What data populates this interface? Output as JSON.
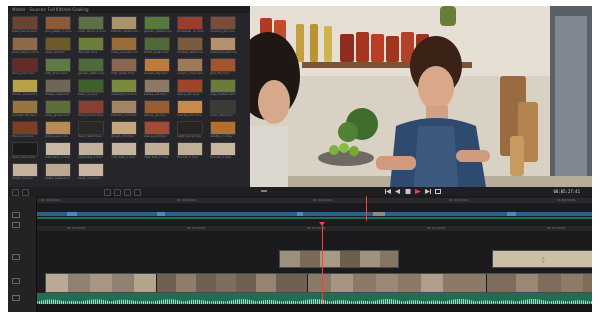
{
  "app": {
    "media_pool": {
      "title": "Master · Sources: Full Kitchen Cooking",
      "clips": [
        {
          "name": "fresh_sauce.mov",
          "tone": "#6b4332"
        },
        {
          "name": "pan_pasta_1.mov",
          "tone": "#8a5a3a"
        },
        {
          "name": "cook_shoot_a.mov",
          "tone": "#5c6f45"
        },
        {
          "name": "kitchen_wide.mov",
          "tone": "#a9936f"
        },
        {
          "name": "garden_herbs.mov",
          "tone": "#567a3e"
        },
        {
          "name": "tomatoes_cu.mov",
          "tone": "#9b3d2c"
        },
        {
          "name": "cooking_09.mov",
          "tone": "#7a4c39"
        },
        {
          "name": "prep_table_2.mov",
          "tone": "#8d6a4a"
        },
        {
          "name": "olive_oil.mov",
          "tone": "#6d5a2a"
        },
        {
          "name": "field_01.mov",
          "tone": "#6a7d3a"
        },
        {
          "name": "vines_sunset.mov",
          "tone": "#9a6d36"
        },
        {
          "name": "herbs_bowl.mov",
          "tone": "#4f6a38"
        },
        {
          "name": "market_stall.mov",
          "tone": "#7b5a3e"
        },
        {
          "name": "bread_dough.mov",
          "tone": "#b4916a"
        },
        {
          "name": "wine_pour.mov",
          "tone": "#6a2a2a"
        },
        {
          "name": "hills_drive.mov",
          "tone": "#5f7a42"
        },
        {
          "name": "garden_walk.mov",
          "tone": "#4d6b3a"
        },
        {
          "name": "chef_smile.mov",
          "tone": "#8a6650"
        },
        {
          "name": "sunset_sky.mov",
          "tone": "#c07a3a"
        },
        {
          "name": "onions_chop.mov",
          "tone": "#9c7a5a"
        },
        {
          "name": "grill_fire.mov",
          "tone": "#a4532a"
        },
        {
          "name": "lemon_slice.mov",
          "tone": "#b7a24a"
        },
        {
          "name": "street_view.mov",
          "tone": "#6e6658"
        },
        {
          "name": "basil_cu.mov",
          "tone": "#3f5f2c"
        },
        {
          "name": "vineyard_01.mov",
          "tone": "#7a8a3e"
        },
        {
          "name": "plates_set.mov",
          "tone": "#8c7a66"
        },
        {
          "name": "sauce_stir.mov",
          "tone": "#a0442c"
        },
        {
          "name": "veg_market.mov",
          "tone": "#6a7b3c"
        },
        {
          "name": "harvest_02.mov",
          "tone": "#96753f"
        },
        {
          "name": "olive_grove.mov",
          "tone": "#5e6e3a"
        },
        {
          "name": "meat_board.mov",
          "tone": "#8a3f34"
        },
        {
          "name": "kitchen_cu2.mov",
          "tone": "#a28466"
        },
        {
          "name": "spices_jar.mov",
          "tone": "#9a5d32"
        },
        {
          "name": "sunrise_hill.mov",
          "tone": "#c8894a"
        },
        {
          "name": "oven_door.mov",
          "tone": "#3e3a36"
        },
        {
          "name": "fire_wood.mov",
          "tone": "#7a3f24"
        },
        {
          "name": "pizza_peel.mov",
          "tone": "#b88a54"
        },
        {
          "name": "dark_cellar.mov",
          "tone": "#2c2826"
        },
        {
          "name": "dough_roll.mov",
          "tone": "#c5a57c"
        },
        {
          "name": "sauce_pot.mov",
          "tone": "#a34a34"
        },
        {
          "name": "night_lamp.mov",
          "tone": "#2a2420"
        },
        {
          "name": "candle_cu.mov",
          "tone": "#b0702e"
        },
        {
          "name": "dark_room.mov",
          "tone": "#1c1a18"
        },
        {
          "name": "interview_1.mov",
          "tone": "#c9b8a3"
        },
        {
          "name": "interview_2.mov",
          "tone": "#c2b19b"
        },
        {
          "name": "chef_talk_1.mov",
          "tone": "#c6b59f"
        },
        {
          "name": "chef_talk_2.mov",
          "tone": "#c0ad96"
        },
        {
          "name": "friends_1.mov",
          "tone": "#bfae98"
        },
        {
          "name": "friends_2.mov",
          "tone": "#c8b7a0"
        },
        {
          "name": "laugh_cu.mov",
          "tone": "#c4b29c"
        },
        {
          "name": "pasta_table.mov",
          "tone": "#bba892"
        },
        {
          "name": "toast_end.mov",
          "tone": "#c9b7a1"
        }
      ]
    },
    "viewer": {
      "timecode": "00:05:27:41"
    },
    "timeline": {
      "overview_labels": [
        "01:00:00:00",
        "01:00:30:00",
        "01:01:00:00",
        "01:01:30:00",
        "01:02:00:00"
      ],
      "ruler_labels": [
        "01:00:40:00",
        "01:00:50:00",
        "01:01:00:00",
        "01:01:10:00",
        "01:01:20:00"
      ]
    }
  }
}
